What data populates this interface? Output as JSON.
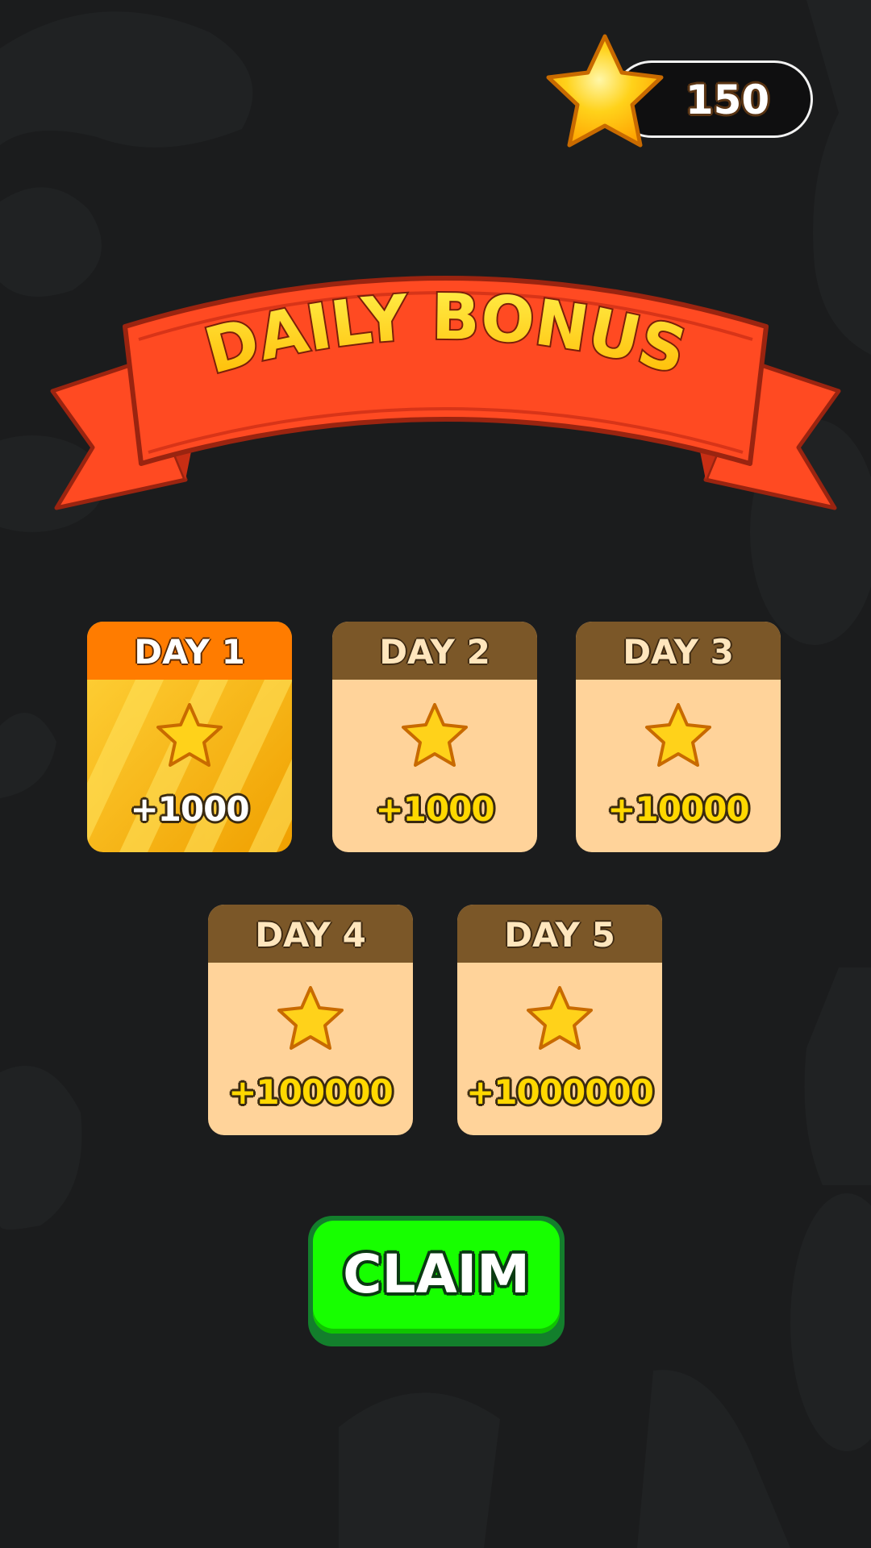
{
  "hud": {
    "star_count": "150",
    "star_icon": "star-icon"
  },
  "banner": {
    "title": "DAILY BONUS"
  },
  "days": [
    {
      "label": "DAY 1",
      "reward": "+1000",
      "active": true
    },
    {
      "label": "DAY 2",
      "reward": "+1000",
      "active": false
    },
    {
      "label": "DAY 3",
      "reward": "+10000",
      "active": false
    },
    {
      "label": "DAY 4",
      "reward": "+100000",
      "active": false
    },
    {
      "label": "DAY 5",
      "reward": "+1000000",
      "active": false
    }
  ],
  "claim": {
    "label": "CLAIM"
  },
  "colors": {
    "background": "#1b1c1d",
    "banner_red": "#ff4a22",
    "banner_text": "#ffd000",
    "card_body": "#ffd39a",
    "card_header": "#7b5728",
    "active_header": "#ff7c00",
    "claim_green": "#17ff00"
  }
}
